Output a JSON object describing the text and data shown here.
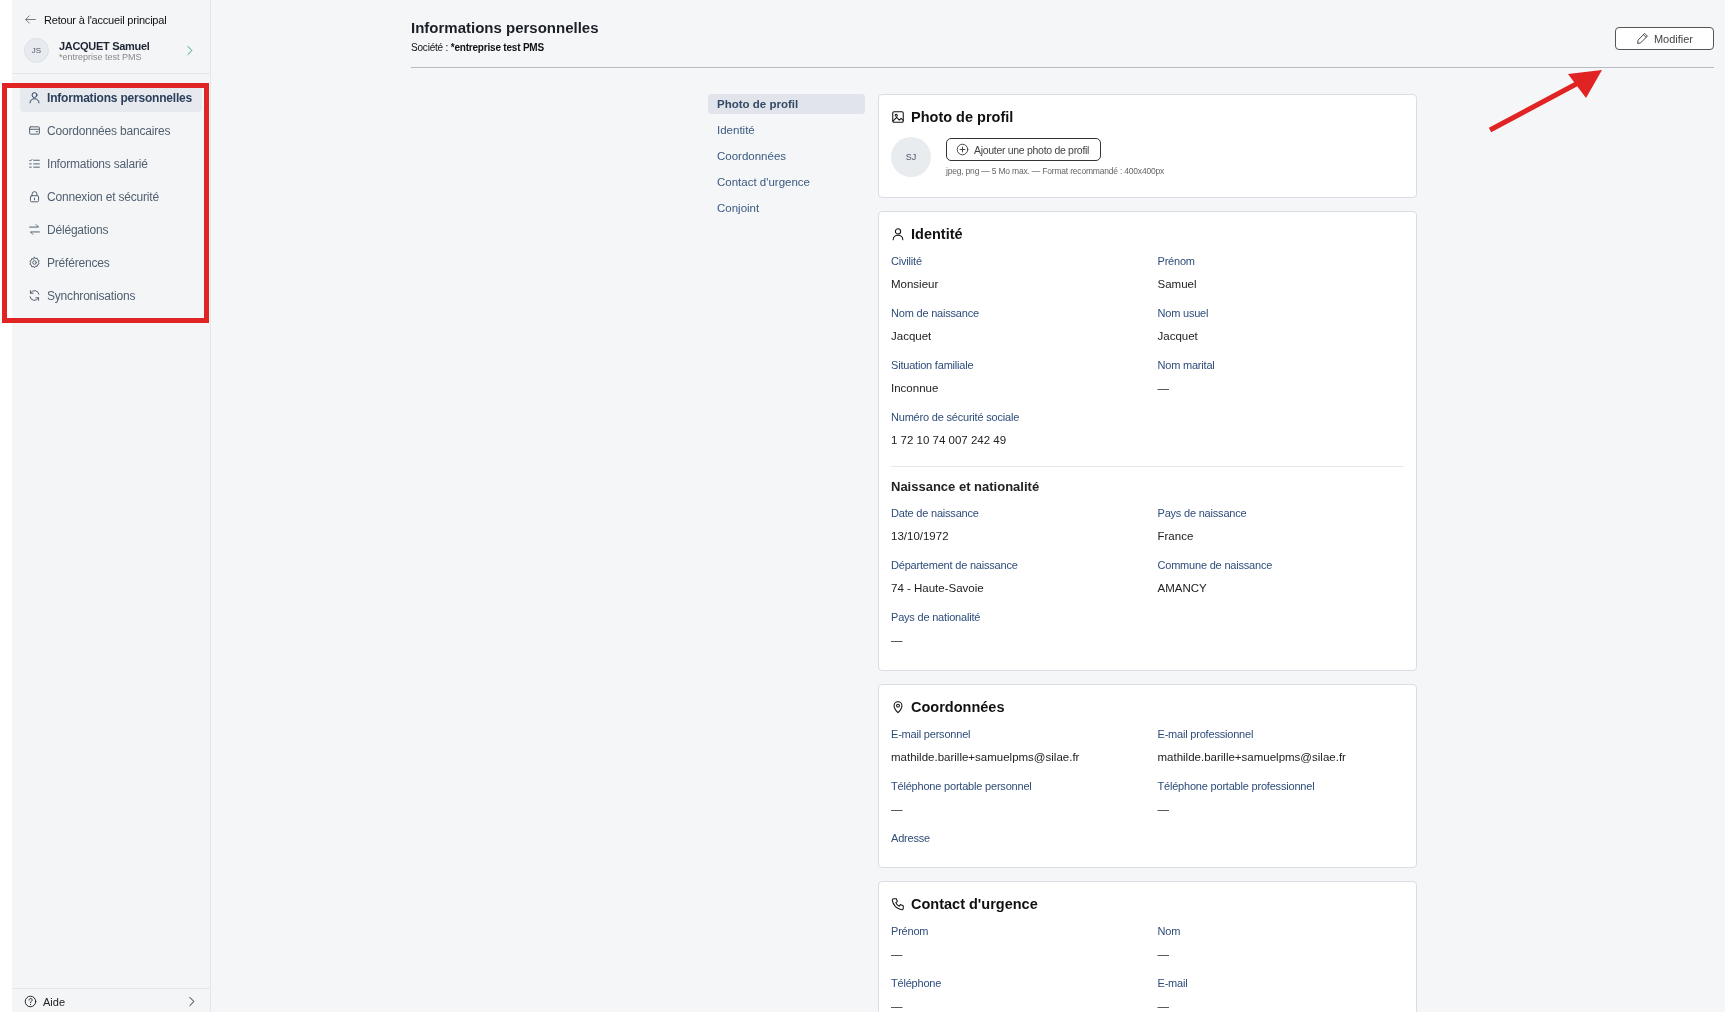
{
  "sidebar": {
    "back_link": "Retour à l'accueil principal",
    "user": {
      "initials": "JS",
      "name": "JACQUET Samuel",
      "company": "*entreprise test PMS"
    },
    "items": [
      {
        "label": "Informations personnelles",
        "selected": true
      },
      {
        "label": "Coordonnées bancaires",
        "selected": false
      },
      {
        "label": "Informations salarié",
        "selected": false
      },
      {
        "label": "Connexion et sécurité",
        "selected": false
      },
      {
        "label": "Délégations",
        "selected": false
      },
      {
        "label": "Préférences",
        "selected": false
      },
      {
        "label": "Synchronisations",
        "selected": false
      }
    ],
    "footer": "Aide"
  },
  "header": {
    "title": "Informations personnelles",
    "company_label": "Société :",
    "company": "*entreprise test PMS",
    "edit_button": "Modifier"
  },
  "section_nav": [
    {
      "label": "Photo de profil",
      "selected": true
    },
    {
      "label": "Identité",
      "selected": false
    },
    {
      "label": "Coordonnées",
      "selected": false
    },
    {
      "label": "Contact d'urgence",
      "selected": false
    },
    {
      "label": "Conjoint",
      "selected": false
    }
  ],
  "cards": [
    {
      "kind": "photo",
      "title": "Photo de profil",
      "initials": "SJ",
      "button": "Ajouter une photo de profil",
      "hint": "jpeg, png — 5 Mo max. — Format recommandé : 400x400px"
    },
    {
      "kind": "fields",
      "title": "Identité",
      "groups": [
        {
          "fields": [
            {
              "label": "Civilité",
              "value": "Monsieur"
            },
            {
              "label": "Prénom",
              "value": "Samuel"
            },
            {
              "label": "Nom de naissance",
              "value": "Jacquet"
            },
            {
              "label": "Nom usuel",
              "value": "Jacquet"
            },
            {
              "label": "Situation familiale",
              "value": "Inconnue"
            },
            {
              "label": "Nom marital",
              "value": "—"
            },
            {
              "label": "Numéro de sécurité sociale",
              "value": "1 72 10 74 007 242 49"
            }
          ]
        },
        {
          "title": "Naissance et nationalité",
          "fields": [
            {
              "label": "Date de naissance",
              "value": "13/10/1972"
            },
            {
              "label": "Pays de naissance",
              "value": "France"
            },
            {
              "label": "Département de naissance",
              "value": "74 - Haute-Savoie"
            },
            {
              "label": "Commune de naissance",
              "value": "AMANCY"
            },
            {
              "label": "Pays de nationalité",
              "value": "—"
            }
          ]
        }
      ]
    },
    {
      "kind": "fields",
      "title": "Coordonnées",
      "groups": [
        {
          "fields": [
            {
              "label": "E-mail personnel",
              "value": "mathilde.barille+samuelpms@silae.fr"
            },
            {
              "label": "E-mail professionnel",
              "value": "mathilde.barille+samuelpms@silae.fr"
            },
            {
              "label": "Téléphone portable personnel",
              "value": "—"
            },
            {
              "label": "Téléphone portable professionnel",
              "value": "—"
            },
            {
              "label": "Adresse"
            }
          ]
        }
      ]
    },
    {
      "kind": "fields",
      "title": "Contact d'urgence",
      "groups": [
        {
          "fields": [
            {
              "label": "Prénom",
              "value": "—"
            },
            {
              "label": "Nom",
              "value": "—"
            },
            {
              "label": "Téléphone",
              "value": "—"
            },
            {
              "label": "E-mail",
              "value": "—"
            }
          ]
        }
      ]
    }
  ],
  "annotations": {
    "highlight_box": true,
    "arrow": true
  }
}
